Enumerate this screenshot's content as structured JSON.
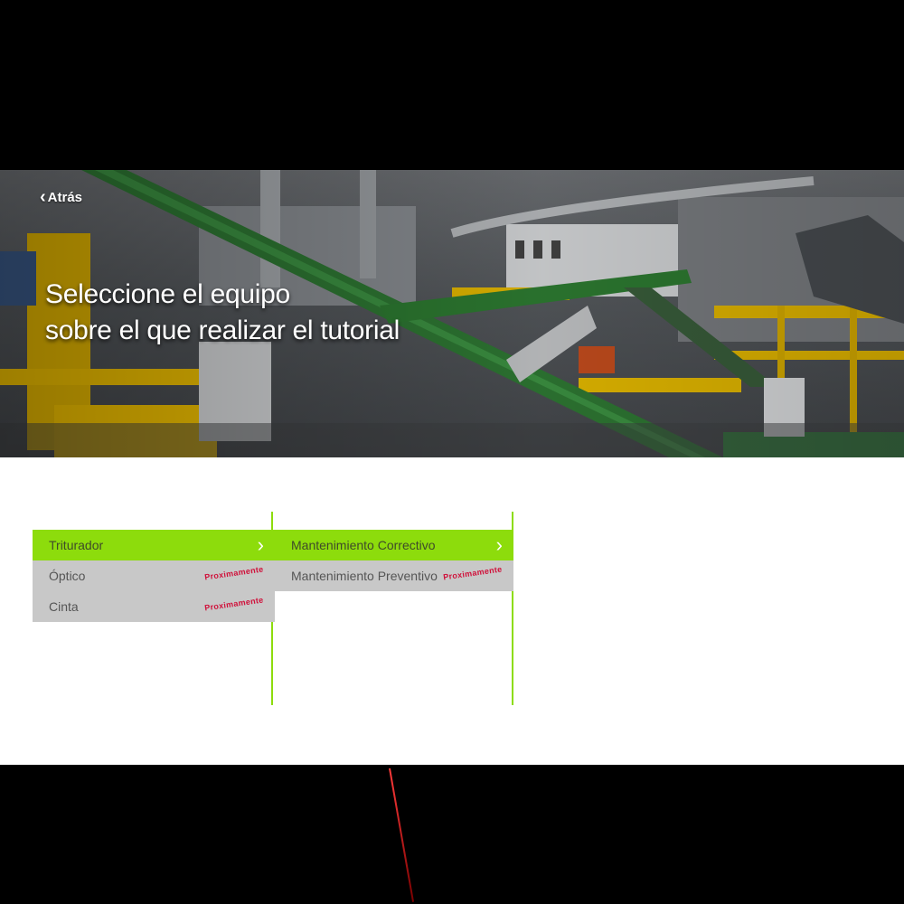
{
  "header": {
    "back_label": "Atrás",
    "title_line1": "Seleccione el equipo",
    "title_line2": "sobre el que realizar el tutorial"
  },
  "equipment_list": [
    {
      "label": "Triturador",
      "active": true,
      "status": ""
    },
    {
      "label": "Óptico",
      "active": false,
      "status": "Proximamente"
    },
    {
      "label": "Cinta",
      "active": false,
      "status": "Proximamente"
    }
  ],
  "tutorial_list": [
    {
      "label": "Mantenimiento Correctivo",
      "active": true,
      "status": ""
    },
    {
      "label": "Mantenimiento Preventivo",
      "active": false,
      "status": "Proximamente"
    }
  ],
  "colors": {
    "accent": "#8ddc0c",
    "item_bg": "#c8c8c8",
    "soon_text": "#d0103a"
  },
  "icons": {
    "back": "chevron-left-icon",
    "item_arrow": "chevron-right-icon"
  }
}
